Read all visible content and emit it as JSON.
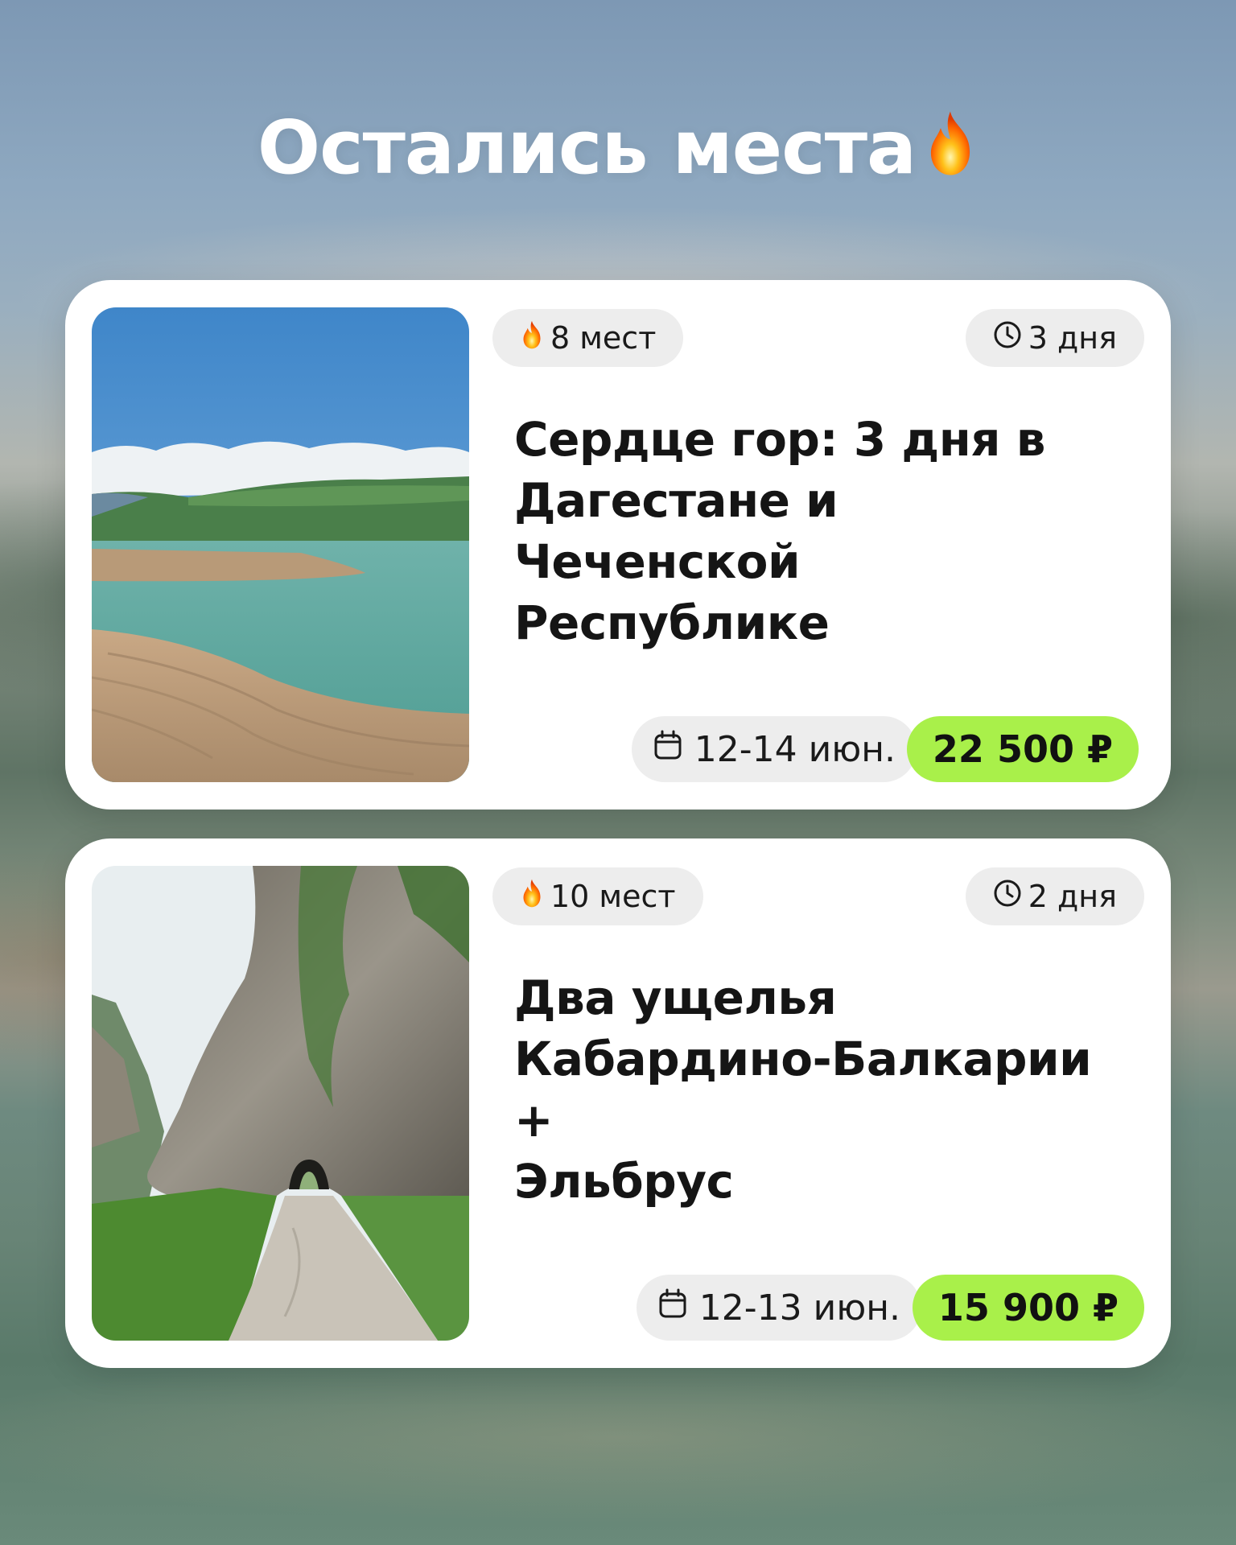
{
  "headline": "Остались места",
  "tours": [
    {
      "spots": "8 мест",
      "duration": "3 дня",
      "title_lines": [
        "Сердце гор: 3 дня в",
        "Дагестане и Чеченской",
        "Республике"
      ],
      "dates": "12-14 июн.",
      "price": "22 500 ₽"
    },
    {
      "spots": "10 мест",
      "duration": "2 дня",
      "title_lines": [
        "Два ущелья",
        "Кабардино-Балкарии +",
        "Эльбрус"
      ],
      "dates": "12-13 июн.",
      "price": "15 900 ₽"
    }
  ],
  "colors": {
    "price_accent": "#a9f04a",
    "pill_bg": "#ededed",
    "card_bg": "#ffffff"
  },
  "icons": [
    "fire-icon",
    "clock-icon",
    "calendar-icon"
  ]
}
